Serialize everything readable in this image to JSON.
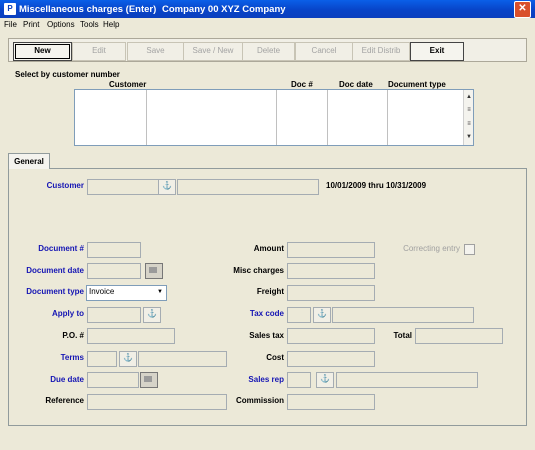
{
  "window": {
    "title": "Miscellaneous charges (Enter)",
    "company": "Company 00  XYZ Company",
    "close_glyph": "✕",
    "app_icon": "P"
  },
  "menu": {
    "items": [
      "File",
      "Print",
      "Options",
      "Tools",
      "Help"
    ]
  },
  "toolbar": {
    "buttons": [
      {
        "label": "New",
        "enabled": true
      },
      {
        "label": "Edit",
        "enabled": false
      },
      {
        "label": "Save",
        "enabled": false
      },
      {
        "label": "Save / New",
        "enabled": false
      },
      {
        "label": "Delete",
        "enabled": false
      },
      {
        "label": "Cancel",
        "enabled": false
      },
      {
        "label": "Edit Distrib",
        "enabled": false
      },
      {
        "label": "Exit",
        "enabled": true
      }
    ]
  },
  "select_group": {
    "label": "Select by customer number",
    "columns": [
      "Customer",
      "Doc #",
      "Doc date",
      "Document type"
    ],
    "scroll_up": "▲",
    "scroll_page_up": "≡",
    "scroll_page_down": "≡",
    "scroll_down": "▼"
  },
  "tabs": [
    "General"
  ],
  "form": {
    "customer_label": "Customer",
    "date_range": "10/01/2009 thru 10/31/2009",
    "document_no_label": "Document #",
    "document_date_label": "Document date",
    "document_type_label": "Document type",
    "document_type_value": "Invoice",
    "apply_to_label": "Apply to",
    "po_label": "P.O. #",
    "terms_label": "Terms",
    "due_date_label": "Due date",
    "reference_label": "Reference",
    "amount_label": "Amount",
    "misc_charges_label": "Misc charges",
    "freight_label": "Freight",
    "tax_code_label": "Tax code",
    "sales_tax_label": "Sales tax",
    "total_label": "Total",
    "cost_label": "Cost",
    "sales_rep_label": "Sales rep",
    "commission_label": "Commission",
    "correcting_entry_label": "Correcting entry",
    "lookup_glyph": "⚓",
    "dropdown_glyph": "▼"
  },
  "colors": {
    "accent_label": "#1515B4",
    "title_bar": "#0A3FBE"
  }
}
